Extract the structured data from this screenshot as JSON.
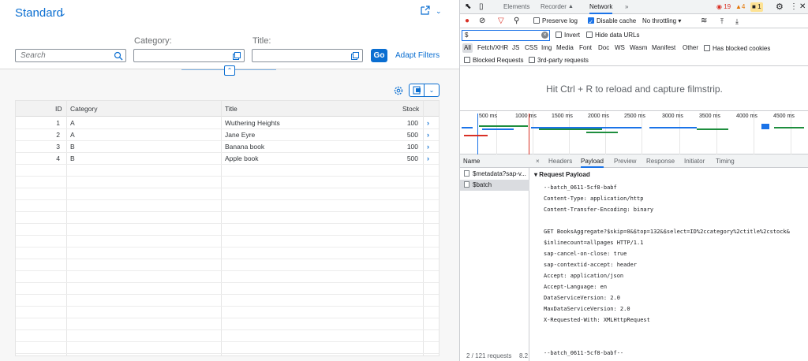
{
  "app": {
    "variant_title": "Standard",
    "filters": {
      "search_placeholder": "Search",
      "category_label": "Category:",
      "title_label": "Title:",
      "go_label": "Go",
      "adapt_label": "Adapt Filters"
    },
    "table": {
      "columns": [
        "ID",
        "Category",
        "Title",
        "Stock"
      ],
      "rows": [
        {
          "id": "1",
          "category": "A",
          "title": "Wuthering Heights",
          "stock": "100"
        },
        {
          "id": "2",
          "category": "A",
          "title": "Jane Eyre",
          "stock": "500"
        },
        {
          "id": "3",
          "category": "B",
          "title": "Banana book",
          "stock": "100"
        },
        {
          "id": "4",
          "category": "B",
          "title": "Apple book",
          "stock": "500"
        }
      ]
    }
  },
  "devtools": {
    "tabs": [
      "Elements",
      "Recorder",
      "Network",
      "»"
    ],
    "active_tab": "Network",
    "errors": "19",
    "warnings": "4",
    "info": "1",
    "toolbar": {
      "preserve_log": "Preserve log",
      "disable_cache": "Disable cache",
      "throttling": "No throttling"
    },
    "filter": {
      "value": "$",
      "invert": "Invert",
      "hide_data_urls": "Hide data URLs",
      "types": [
        "All",
        "Fetch/XHR",
        "JS",
        "CSS",
        "Img",
        "Media",
        "Font",
        "Doc",
        "WS",
        "Wasm",
        "Manifest",
        "Other"
      ],
      "has_blocked_cookies": "Has blocked cookies",
      "blocked_requests": "Blocked Requests",
      "third_party": "3rd-party requests"
    },
    "filmstrip_message": "Hit Ctrl + R to reload and capture filmstrip.",
    "timeline_ticks": [
      "500 ms",
      "1000 ms",
      "1500 ms",
      "2000 ms",
      "2500 ms",
      "3000 ms",
      "3500 ms",
      "4000 ms",
      "4500 ms"
    ],
    "name_header": "Name",
    "requests": [
      "$metadata?sap-v...",
      "$batch"
    ],
    "detail_tabs": [
      "×",
      "Headers",
      "Payload",
      "Preview",
      "Response",
      "Initiator",
      "Timing"
    ],
    "active_detail_tab": "Payload",
    "payload_title": "▾ Request Payload",
    "payload_lines": [
      "--batch_0611-5cf8-babf",
      "Content-Type: application/http",
      "Content-Transfer-Encoding: binary",
      "",
      "GET BooksAggregate?$skip=0&$top=132&$select=ID%2ccategory%2ctitle%2cstock&",
      "$inlinecount=allpages HTTP/1.1",
      "sap-cancel-on-close: true",
      "sap-contextid-accept: header",
      "Accept: application/json",
      "Accept-Language: en",
      "DataServiceVersion: 2.0",
      "MaxDataServiceVersion: 2.0",
      "X-Requested-With: XMLHttpRequest",
      "",
      "",
      "--batch_0611-5cf8-babf--"
    ],
    "status_text": "2 / 121 requests",
    "status_size": "8.2"
  },
  "colors": {
    "sap_blue": "#0a6ed1",
    "devtools_blue": "#1a73e8"
  }
}
